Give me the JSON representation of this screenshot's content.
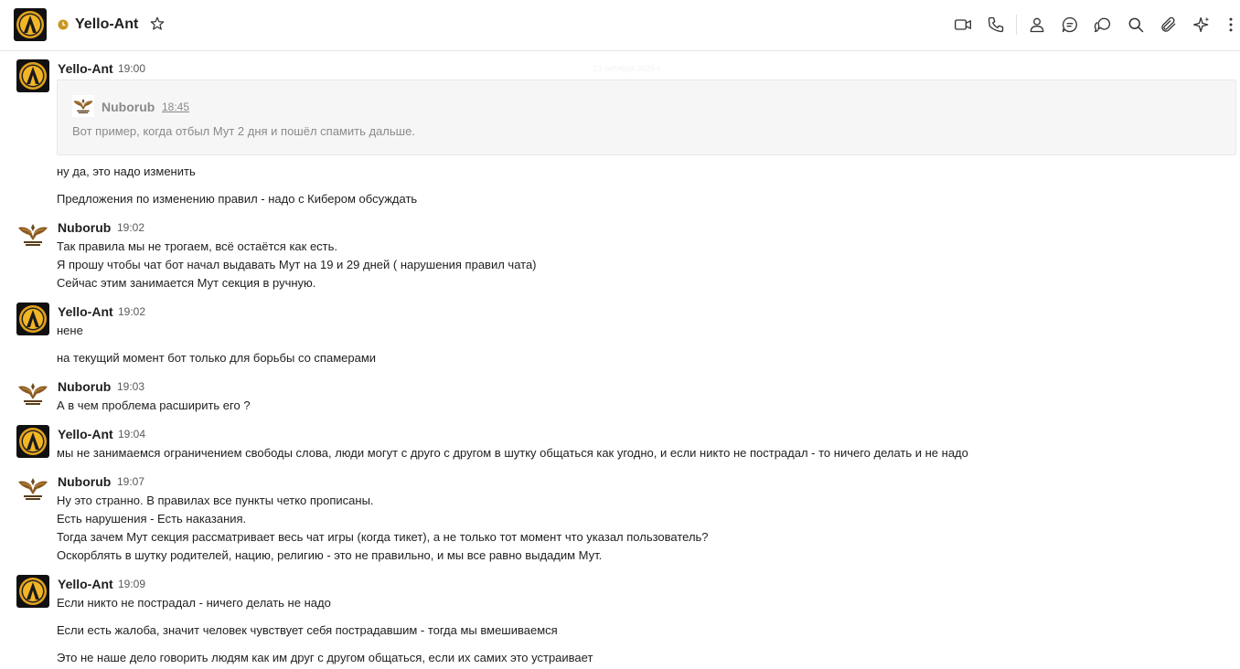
{
  "header": {
    "title": "Yello-Ant",
    "icons": [
      "video-call-icon",
      "phone-icon",
      "person-icon",
      "chat-bubble-icon",
      "threads-icon",
      "search-icon",
      "paperclip-icon",
      "sparkle-icon",
      "more-icon"
    ]
  },
  "date_divider": "13 октября 2025 г.",
  "messages": [
    {
      "author": "Yello-Ant",
      "time": "19:00",
      "quote": {
        "author": "Nuborub",
        "time": "18:45",
        "text": "Вот пример, когда отбыл Мут 2 дня и пошёл спамить дальше."
      },
      "lines": [
        "ну да, это надо изменить",
        "Предложения по изменению правил - надо с Кибером обсуждать"
      ]
    },
    {
      "author": "Nuborub",
      "time": "19:02",
      "lines": [
        "Так правила мы не трогаем, всё остаётся как есть.",
        "Я прошу чтобы чат бот начал выдавать Мут на 19 и 29 дней ( нарушения правил чата)",
        "Сейчас этим занимается Мут секция в ручную."
      ]
    },
    {
      "author": "Yello-Ant",
      "time": "19:02",
      "lines": [
        "нене",
        "на текущий момент бот только для борьбы со спамерами"
      ]
    },
    {
      "author": "Nuborub",
      "time": "19:03",
      "lines": [
        "А в чем проблема расширить его ?"
      ]
    },
    {
      "author": "Yello-Ant",
      "time": "19:04",
      "lines": [
        "мы не занимаемся ограничением свободы слова, люди могут с друго с другом в шутку общаться как угодно, и если никто не пострадал - то ничего делать и не надо"
      ]
    },
    {
      "author": "Nuborub",
      "time": "19:07",
      "lines": [
        "Ну это странно. В правилах все пункты четко прописаны.",
        "Есть нарушения - Есть наказания.",
        "Тогда зачем Мут секция рассматривает весь чат игры (когда тикет), а не только тот момент что указал пользователь?",
        "Оскорблять в шутку родителей, нацию, религию - это не правильно, и мы все равно выдадим Мут."
      ]
    },
    {
      "author": "Yello-Ant",
      "time": "19:09",
      "lines": [
        "Если никто не пострадал - ничего делать не надо",
        "Если есть жалоба, значит человек чувствует себя пострадавшим - тогда мы вмешиваемся",
        "Это не наше дело говорить людям как им друг с другом общаться, если их самих это устраивает"
      ]
    }
  ],
  "colors": {
    "status_away": "#c8961e",
    "avatar_ring": "#e0a020",
    "avatar_bg": "#111111"
  }
}
